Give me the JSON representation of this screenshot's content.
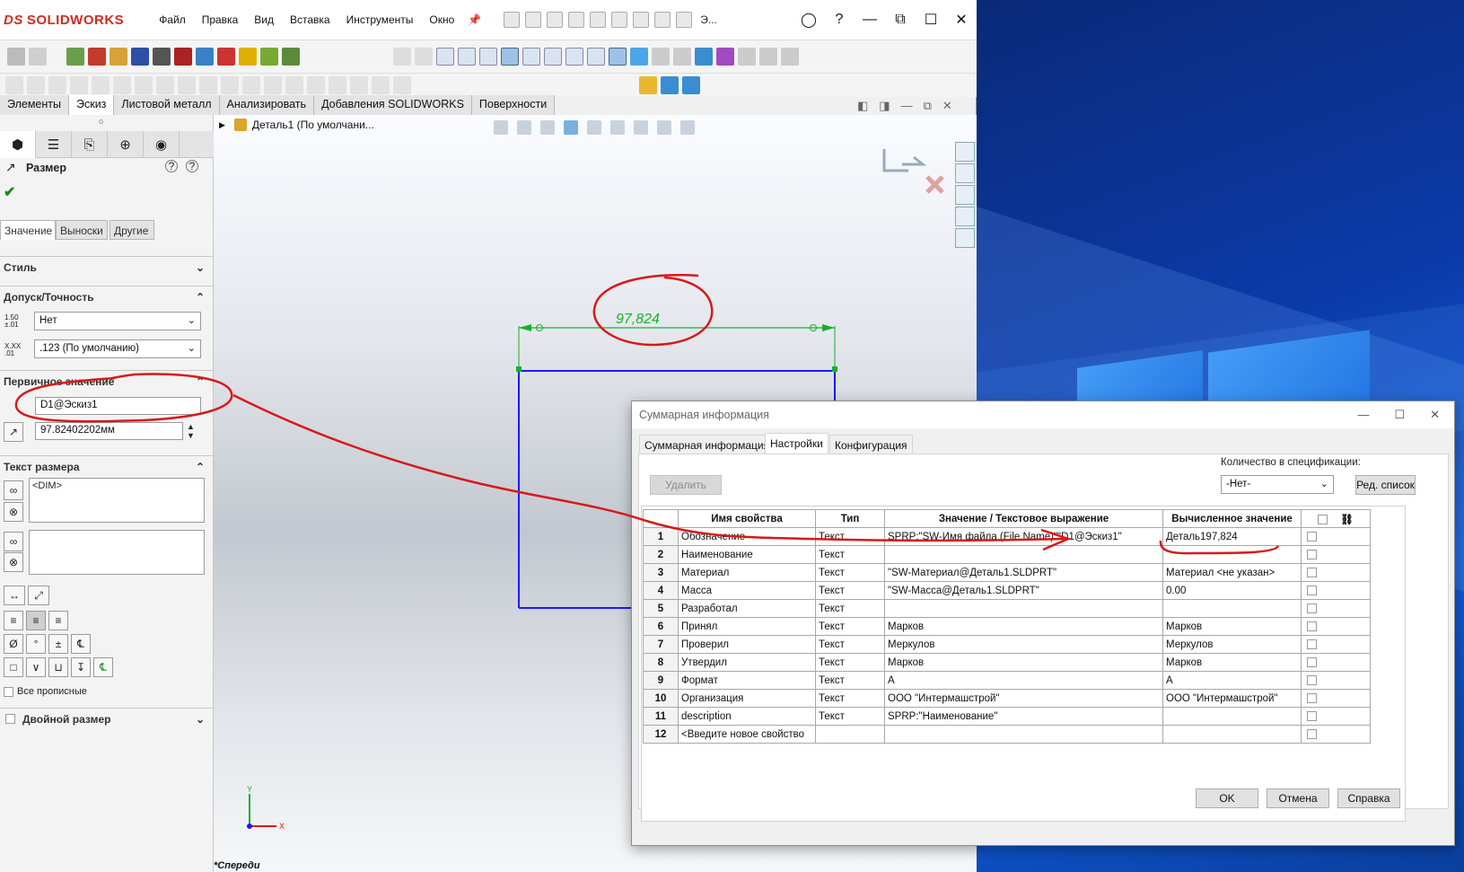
{
  "app": {
    "brand": "SOLIDWORKS",
    "brand_prefix": "DS",
    "menu": [
      "Файл",
      "Правка",
      "Вид",
      "Вставка",
      "Инструменты",
      "Окно"
    ],
    "search_hint": "Э..."
  },
  "command_tabs": [
    "Элементы",
    "Эскиз",
    "Листовой металл",
    "Анализировать",
    "Добавления SOLIDWORKS",
    "Поверхности"
  ],
  "command_tabs_active": "Эскиз",
  "tree": {
    "part_label": "Деталь1  (По умолчани..."
  },
  "property_manager": {
    "title": "Размер",
    "subtabs": [
      "Значение",
      "Выноски",
      "Другие"
    ],
    "sections": {
      "style": "Стиль",
      "tolerance": "Допуск/Точность",
      "primary_value": "Первичное значение",
      "dim_text": "Текст размера",
      "dual_dim": "Двойной размер"
    },
    "tolerance_type": "Нет",
    "precision": ".123 (По умолчанию)",
    "dimension_name": "D1@Эскиз1",
    "dimension_value": "97.82402202мм",
    "dim_text_value": "<DIM>",
    "all_caps_label": "Все прописные"
  },
  "viewport": {
    "dimension_label": "97,824",
    "orientation": "*Спереди",
    "axis_x": "X",
    "axis_y": "Y"
  },
  "dialog": {
    "title": "Суммарная информация",
    "tabs": [
      "Суммарная информация",
      "Настройки",
      "Конфигурация"
    ],
    "active_tab": "Настройки",
    "delete_button": "Удалить",
    "bom_qty_label": "Количество в спецификации:",
    "bom_qty_value": "-Нет-",
    "edit_list_button": "Ред. список",
    "columns": [
      "Имя свойства",
      "Тип",
      "Значение / Текстовое выражение",
      "Вычисленное значение"
    ],
    "rows": [
      {
        "n": "1",
        "name": "Обозначение",
        "type": "Текст",
        "expr": "SPRP:\"SW-Имя файла (File Name)\"\"D1@Эскиз1\"",
        "value": "Деталь197,824"
      },
      {
        "n": "2",
        "name": "Наименование",
        "type": "Текст",
        "expr": "",
        "value": ""
      },
      {
        "n": "3",
        "name": "Материал",
        "type": "Текст",
        "expr": "\"SW-Материал@Деталь1.SLDPRT\"",
        "value": "Материал <не указан>"
      },
      {
        "n": "4",
        "name": "Масса",
        "type": "Текст",
        "expr": "\"SW-Масса@Деталь1.SLDPRT\"",
        "value": "0.00"
      },
      {
        "n": "5",
        "name": "Разработал",
        "type": "Текст",
        "expr": "",
        "value": ""
      },
      {
        "n": "6",
        "name": "Принял",
        "type": "Текст",
        "expr": "Марков",
        "value": "Марков"
      },
      {
        "n": "7",
        "name": "Проверил",
        "type": "Текст",
        "expr": "Меркулов",
        "value": "Меркулов"
      },
      {
        "n": "8",
        "name": "Утвердил",
        "type": "Текст",
        "expr": "Марков",
        "value": "Марков"
      },
      {
        "n": "9",
        "name": "Формат",
        "type": "Текст",
        "expr": "A",
        "value": "A"
      },
      {
        "n": "10",
        "name": "Организация",
        "type": "Текст",
        "expr": "ООО \"Интермашстрой\"",
        "value": "ООО \"Интермашстрой\""
      },
      {
        "n": "11",
        "name": "description",
        "type": "Текст",
        "expr": "SPRP:\"Наименование\"",
        "value": ""
      },
      {
        "n": "12",
        "name": "<Введите новое свойство",
        "type": "",
        "expr": "",
        "value": ""
      }
    ],
    "ok": "OK",
    "cancel": "Отмена",
    "help": "Справка"
  },
  "colors": {
    "brand_red": "#d52b1e",
    "sketch_blue": "#1a1aff",
    "dimension_green": "#16b02b",
    "annotation_red": "#d91818",
    "desktop_blue": "#0b3aa8"
  }
}
